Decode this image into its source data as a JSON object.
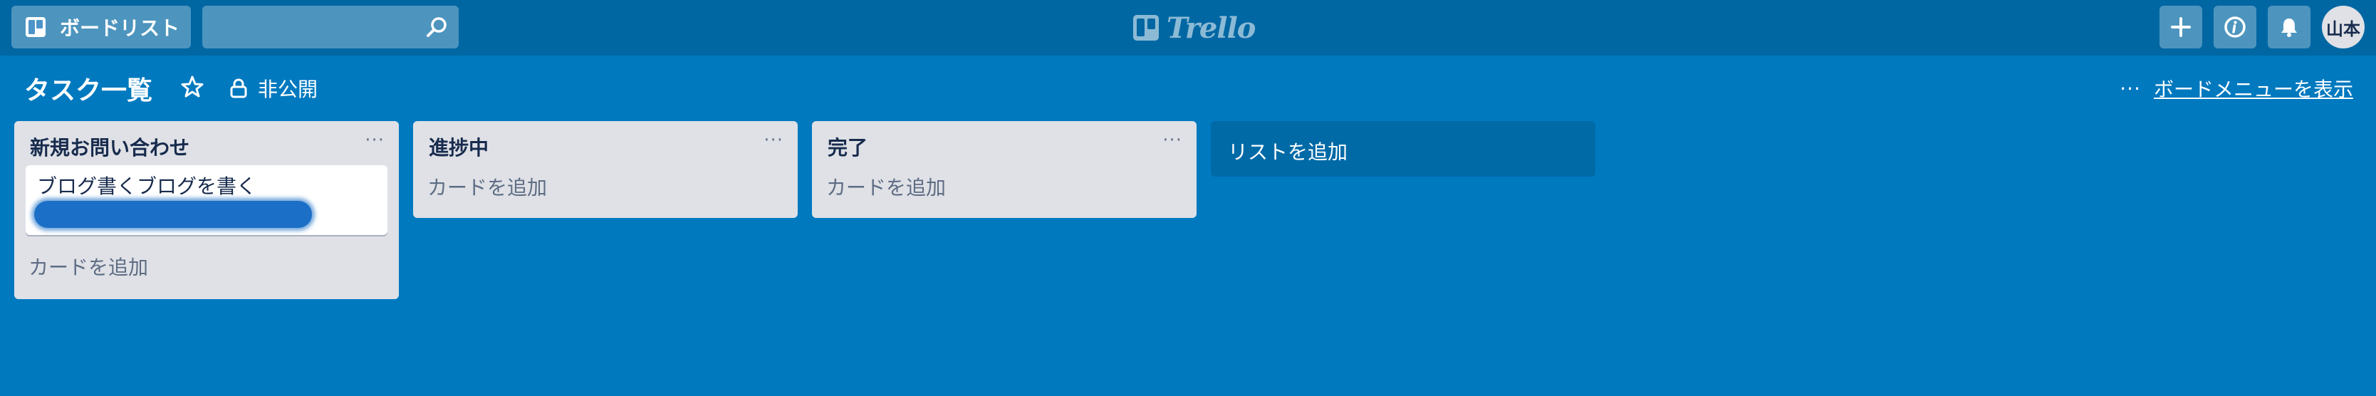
{
  "header": {
    "boards_label": "ボードリスト",
    "search_placeholder": "",
    "logo_text": "Trello",
    "avatar_initials": "山本",
    "icons": [
      "board-icon",
      "search-icon",
      "trello-logo-icon",
      "plus-icon",
      "info-icon",
      "bell-icon"
    ]
  },
  "board": {
    "title": "タスク一覧",
    "visibility": "非公開",
    "menu_dots": "···",
    "menu_label": "ボードメニューを表示"
  },
  "lists": [
    {
      "title": "新規お問い合わせ",
      "menu": "···",
      "cards": [
        {
          "text": "ブログ書くブログを書く",
          "redacted": true
        }
      ],
      "add_card": "カードを追加"
    },
    {
      "title": "進捗中",
      "menu": "···",
      "cards": [],
      "add_card": "カードを追加"
    },
    {
      "title": "完了",
      "menu": "···",
      "cards": [],
      "add_card": "カードを追加"
    }
  ],
  "add_list": "リストを追加",
  "colors": {
    "board_bg": "#0079bf",
    "header_bg": "#0067a3",
    "list_bg": "#dfe1e6",
    "card_bg": "#ffffff",
    "redaction": "#1c6fc6"
  }
}
